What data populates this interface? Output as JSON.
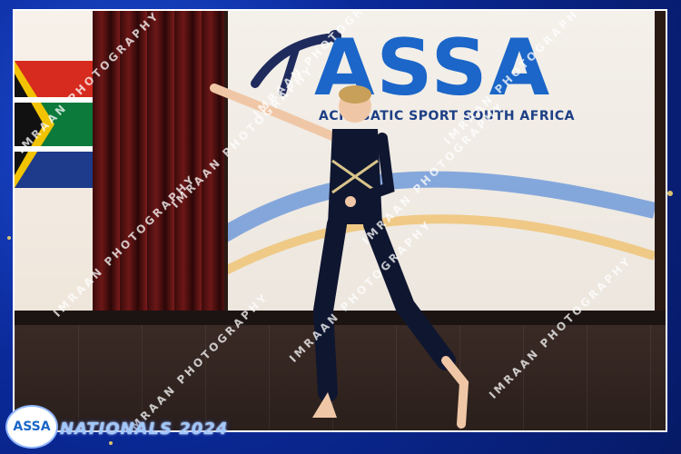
{
  "frame": {
    "background": "#0d2a8a",
    "accent": "#f3d36b"
  },
  "banner": {
    "logo_text": "ASSA",
    "tagline": "ACROBATIC SPORT SOUTH AFRICA"
  },
  "watermark": {
    "text": "IMRAAN PHOTOGRAPHY"
  },
  "footer": {
    "event_logo_text": "ASSA",
    "event_title": "NATIONALS 2024"
  },
  "icons": [
    "south-africa-flag-icon",
    "assa-gymnast-logo-icon"
  ]
}
